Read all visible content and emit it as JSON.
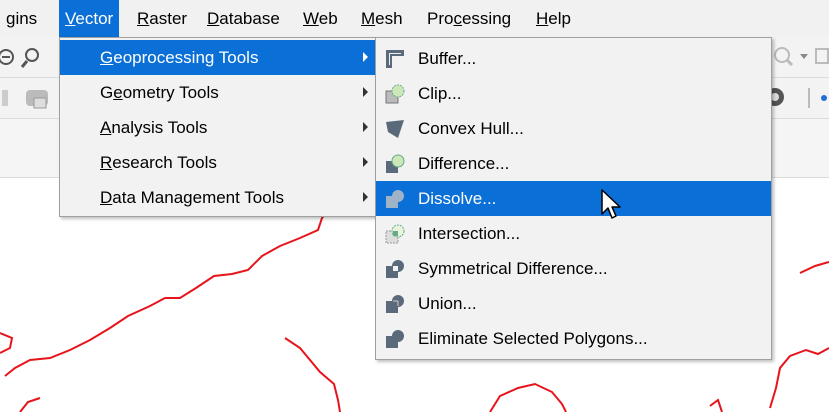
{
  "menubar": {
    "items": [
      {
        "label": "gins"
      },
      {
        "label": "Vector"
      },
      {
        "label": "Raster"
      },
      {
        "label": "Database"
      },
      {
        "label": "Web"
      },
      {
        "label": "Mesh"
      },
      {
        "label": "Processing"
      },
      {
        "label": "Help"
      }
    ]
  },
  "vector_menu": {
    "items": [
      {
        "label": "Geoprocessing Tools",
        "highlighted": true
      },
      {
        "label": "Geometry Tools"
      },
      {
        "label": "Analysis Tools"
      },
      {
        "label": "Research Tools"
      },
      {
        "label": "Data Management Tools"
      }
    ]
  },
  "geoprocessing_menu": {
    "items": [
      {
        "label": "Buffer...",
        "icon": "buffer-icon"
      },
      {
        "label": "Clip...",
        "icon": "clip-icon"
      },
      {
        "label": "Convex Hull...",
        "icon": "convex-hull-icon"
      },
      {
        "label": "Difference...",
        "icon": "difference-icon"
      },
      {
        "label": "Dissolve...",
        "icon": "dissolve-icon",
        "highlighted": true
      },
      {
        "label": "Intersection...",
        "icon": "intersection-icon"
      },
      {
        "label": "Symmetrical Difference...",
        "icon": "symmetrical-difference-icon"
      },
      {
        "label": "Union...",
        "icon": "union-icon"
      },
      {
        "label": "Eliminate Selected Polygons...",
        "icon": "eliminate-icon"
      }
    ]
  },
  "colors": {
    "highlight": "#0a6fd6",
    "map_boundary": "#e8141c"
  }
}
